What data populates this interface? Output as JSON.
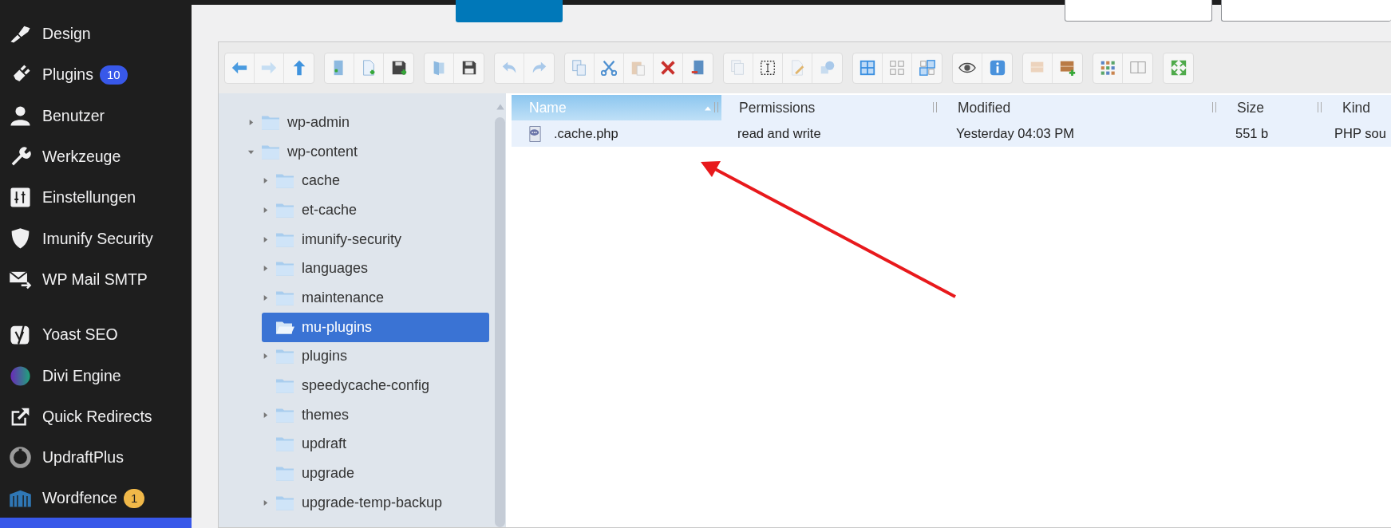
{
  "sidebar": {
    "groups": [
      {
        "items": [
          {
            "label": "Design"
          },
          {
            "label": "Plugins",
            "badge": {
              "text": "10",
              "color": "#3858e9"
            }
          },
          {
            "label": "Benutzer"
          },
          {
            "label": "Werkzeuge"
          },
          {
            "label": "Einstellungen"
          },
          {
            "label": "Imunify Security"
          },
          {
            "label": "WP Mail SMTP"
          }
        ]
      },
      {
        "items": [
          {
            "label": "Yoast SEO"
          },
          {
            "label": "Divi Engine"
          },
          {
            "label": "Quick Redirects"
          },
          {
            "label": "UpdraftPlus"
          },
          {
            "label": "Wordfence",
            "badge": {
              "text": "1",
              "color": "#f0b849"
            }
          }
        ]
      }
    ]
  },
  "file_manager": {
    "tree": [
      {
        "label": "wp-admin",
        "expanded": false,
        "selected": false
      },
      {
        "label": "wp-content",
        "expanded": true,
        "selected": false,
        "children": [
          {
            "label": "cache",
            "expanded": false,
            "selected": false
          },
          {
            "label": "et-cache",
            "expanded": false,
            "selected": false
          },
          {
            "label": "imunify-security",
            "expanded": false,
            "selected": false
          },
          {
            "label": "languages",
            "expanded": false,
            "selected": false
          },
          {
            "label": "maintenance",
            "expanded": false,
            "selected": false
          },
          {
            "label": "mu-plugins",
            "selected": true
          },
          {
            "label": "plugins",
            "expanded": false,
            "selected": false
          },
          {
            "label": "speedycache-config",
            "selected": false
          },
          {
            "label": "themes",
            "expanded": false,
            "selected": false
          },
          {
            "label": "updraft",
            "selected": false
          },
          {
            "label": "upgrade",
            "selected": false
          },
          {
            "label": "upgrade-temp-backup",
            "expanded": false,
            "selected": false
          }
        ]
      }
    ],
    "columns": [
      {
        "label": "Name",
        "selected": true
      },
      {
        "label": "Permissions",
        "selected": false
      },
      {
        "label": "Modified",
        "selected": false
      },
      {
        "label": "Size",
        "selected": false
      },
      {
        "label": "Kind",
        "selected": false
      }
    ],
    "rows": [
      {
        "cells": [
          ".cache.php",
          "read and write",
          "Yesterday 04:03 PM",
          "551 b",
          "PHP sou"
        ],
        "selected": true
      }
    ]
  }
}
